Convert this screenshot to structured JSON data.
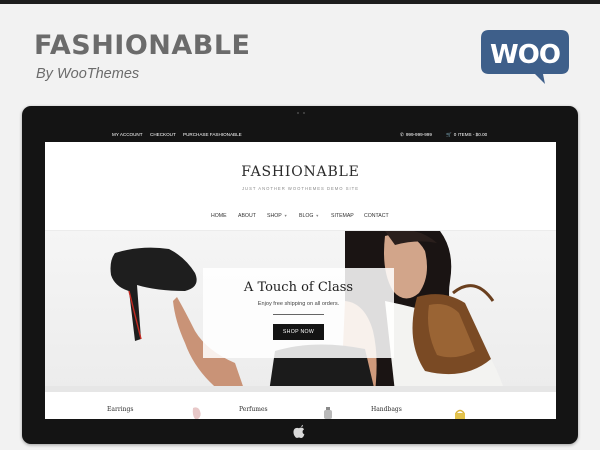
{
  "showcase": {
    "title": "FASHIONABLE",
    "byline": "By WooThemes",
    "logo_text": "WOO",
    "logo_color": "#3e5f8a"
  },
  "site": {
    "topbar": {
      "links": [
        "MY ACCOUNT",
        "CHECKOUT",
        "PURCHASE FASHIONABLE"
      ],
      "phone": "999-999-999",
      "cart": "0 ITEMS - $0.00"
    },
    "title": "FASHIONABLE",
    "tagline": "JUST ANOTHER WOOTHEMES DEMO SITE",
    "nav": [
      {
        "label": "HOME"
      },
      {
        "label": "ABOUT"
      },
      {
        "label": "SHOP"
      },
      {
        "label": "BLOG"
      },
      {
        "label": "SITEMAP"
      },
      {
        "label": "CONTACT"
      }
    ],
    "hero": {
      "title": "A Touch of Class",
      "subtitle": "Enjoy free shipping on all orders.",
      "button": "SHOP NOW"
    },
    "categories": [
      {
        "label": "Earrings"
      },
      {
        "label": "Perfumes"
      },
      {
        "label": "Handbags"
      }
    ]
  },
  "icons": [
    "woo-logo",
    "apple-icon",
    "phone-icon",
    "cart-icon",
    "chevron-down-icon",
    "camera-icon"
  ]
}
